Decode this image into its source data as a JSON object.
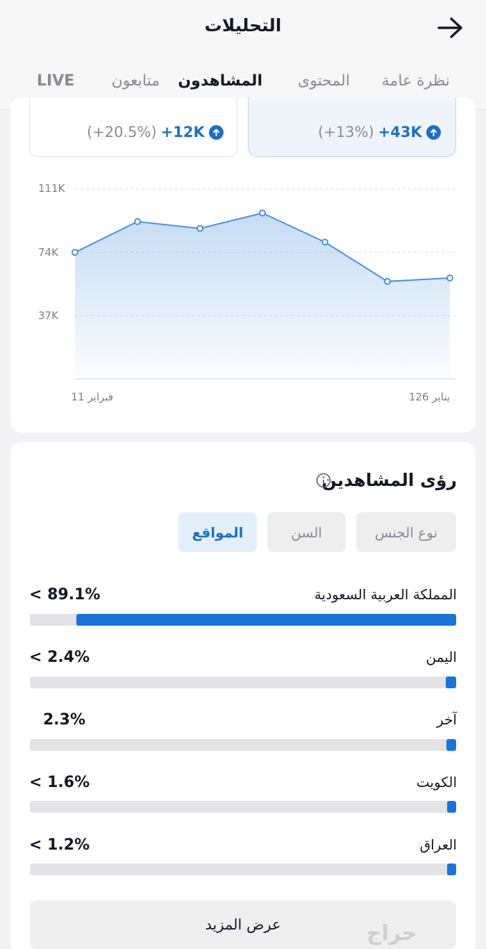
{
  "header": {
    "title": "التحليلات",
    "tabs": [
      {
        "label": "نظرة عامة",
        "active": false
      },
      {
        "label": "المحتوى",
        "active": false
      },
      {
        "label": "المشاهدون",
        "active": true
      },
      {
        "label": "متابعون",
        "active": false
      },
      {
        "label": "LIVE",
        "active": false
      }
    ]
  },
  "stats": {
    "right": {
      "value": "+43K",
      "change": "(+13%)"
    },
    "left": {
      "value": "+12K",
      "change": "(+20.5%)"
    }
  },
  "chart_data": {
    "type": "area",
    "x_start_label": "فبراير 11",
    "x_end_label": "يناير 126",
    "y_ticks": [
      "111K",
      "74K",
      "37K"
    ],
    "y_tick_values": [
      111000,
      74000,
      37000
    ],
    "ylim": [
      0,
      111000
    ],
    "grid": true,
    "values": [
      74000,
      92000,
      88000,
      97000,
      80000,
      57000,
      59000
    ],
    "color": "#4a90d9"
  },
  "insights": {
    "title": "رؤى المشاهدين",
    "filters": [
      {
        "label": "نوع الجنس",
        "active": false
      },
      {
        "label": "السن",
        "active": false
      },
      {
        "label": "المواقع",
        "active": true
      }
    ],
    "locations": [
      {
        "name": "المملكة العربية السعودية",
        "percent": "89.1%",
        "fraction": 0.891,
        "chevron": true
      },
      {
        "name": "اليمن",
        "percent": "2.4%",
        "fraction": 0.024,
        "chevron": true
      },
      {
        "name": "آخر",
        "percent": "2.3%",
        "fraction": 0.023,
        "chevron": false
      },
      {
        "name": "الكويت",
        "percent": "1.6%",
        "fraction": 0.016,
        "chevron": true
      },
      {
        "name": "العراق",
        "percent": "1.2%",
        "fraction": 0.012,
        "chevron": true
      }
    ],
    "more_label": "عرض المزيد"
  },
  "watermark": "حراج",
  "colors": {
    "accent": "#1f6fc0",
    "bar": "#1a73d9"
  }
}
